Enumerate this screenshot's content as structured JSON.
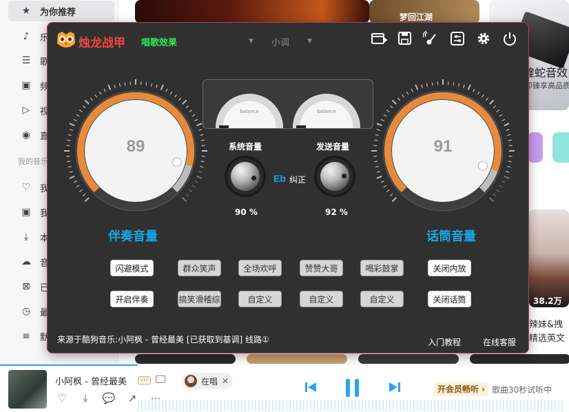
{
  "sidebar": {
    "items": [
      {
        "label": "为你推荐",
        "icon": "star-icon"
      },
      {
        "label": "乐",
        "icon": "music-note-icon"
      },
      {
        "label": "歌",
        "icon": "list-icon"
      },
      {
        "label": "频",
        "icon": "radio-icon"
      },
      {
        "label": "视",
        "icon": "video-icon"
      },
      {
        "label": "直",
        "icon": "live-icon"
      },
      {
        "label": "我",
        "icon": "heart-icon"
      },
      {
        "label": "我",
        "icon": "radio-icon"
      },
      {
        "label": "本",
        "icon": "download-icon"
      },
      {
        "label": "音",
        "icon": "cloud-icon"
      },
      {
        "label": "已",
        "icon": "bag-icon"
      },
      {
        "label": "最",
        "icon": "clock-icon"
      },
      {
        "label": "默",
        "icon": "playlist-icon"
      }
    ],
    "section_label": "我的音乐"
  },
  "background": {
    "tile_top_right_label": "梦回江湖",
    "promo_title": "蝰蛇音效",
    "promo_sub": "即臻享高品质",
    "artist_count": "38.2万",
    "artist_caption_1": "辣妹&拽",
    "artist_caption_2": "精选英文"
  },
  "panel": {
    "brand": "烛龙战甲",
    "mode": "唱歌效果",
    "key_select": "小调",
    "accompany": {
      "value": "89",
      "level": 89,
      "label": "伴奏音量"
    },
    "mic": {
      "value": "91",
      "level": 91,
      "label": "话筒音量"
    },
    "meter_label": "balance",
    "system_volume": {
      "title": "系统音量",
      "pct": "90 %"
    },
    "send_volume": {
      "title": "发送音量",
      "pct": "92 %"
    },
    "key_name": "Eb",
    "key_correct": "纠正",
    "buttons_row1": [
      "闪避模式",
      "群众笑声",
      "全场欢呼",
      "赞赞大哥",
      "喝彩鼓掌",
      "关闭内放"
    ],
    "buttons_row2": [
      "开启伴奏",
      "搞笑滑稽综",
      "自定义",
      "自定义",
      "自定义",
      "关闭话筒"
    ],
    "footer_info": "来源于酷狗音乐:小阿枫 - 曾经最美 [已获取到基调] 线路①",
    "tutorial": "入门教程",
    "support": "在线客服"
  },
  "player": {
    "song": "小阿枫 - 曾经最美",
    "vip": "VIP",
    "singing": "在唱",
    "vip_button": "开会员畅听 ›",
    "trial_text": "歌曲30秒试听中"
  },
  "colors": {
    "accent_blue": "#17a6e6",
    "dial_orange": "#e98a3a",
    "brand_red": "#f5463a",
    "mode_green": "#2ee84a",
    "player_blue": "#2aa4f4"
  }
}
